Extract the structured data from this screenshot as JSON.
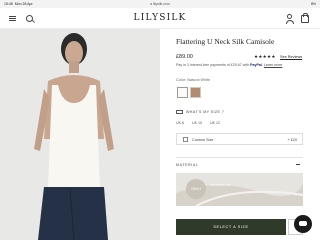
{
  "statusbar": {
    "time": "15:45",
    "date": "Mon 28 Apr",
    "url": "a lilysilk.com",
    "battery": "8%"
  },
  "header": {
    "logo": "LILYSILK"
  },
  "product": {
    "title": "Flattering U Neck Silk Camisole",
    "price": "£89.00",
    "rating_stars": "★★★★★",
    "reviews_link": "See Reviews",
    "paypal_prefix": "Pay in 3 interest-free payments of £29.67 with",
    "paypal_brand": "PayPal",
    "paypal_link": "Learn more",
    "color_label": "Color: Natural White",
    "swatches": [
      "#fbfaf6",
      "#b08d72"
    ],
    "size_guide": "WHAT'S MY SIZE ?",
    "sizes": [
      "UK 6",
      "UK 10",
      "UK 12"
    ],
    "custom_size_label": "Custom Size",
    "custom_size_price": "+ £20",
    "material_heading": "MATERIAL",
    "material_badge": "OEKO",
    "material_badge_text": "STANDARD 100",
    "select_button": "SELECT A SIZE"
  },
  "colors": {
    "accent": "#2f3a2a"
  }
}
